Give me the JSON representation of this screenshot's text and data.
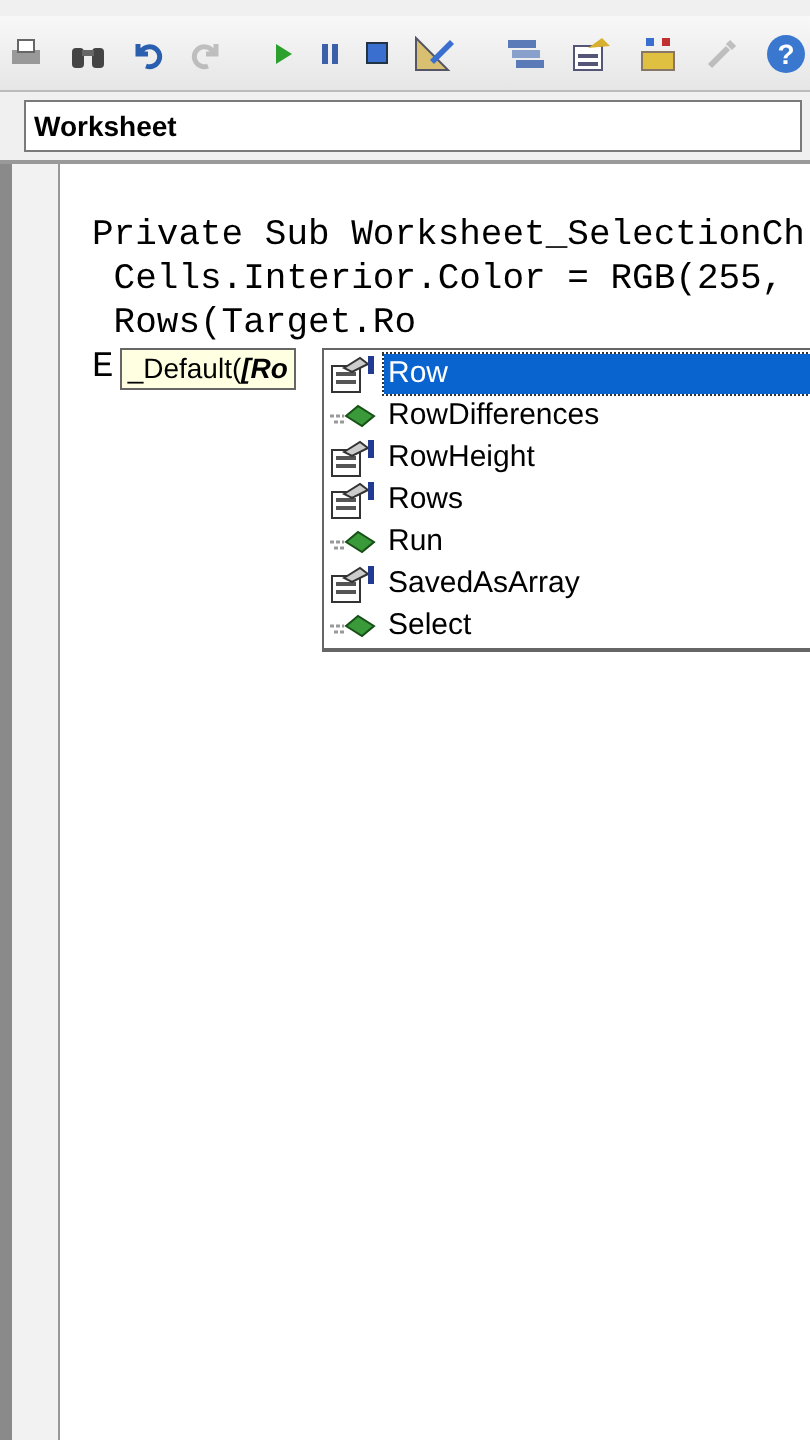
{
  "toolbar": [
    {
      "kind": "print",
      "disabled": false
    },
    {
      "kind": "find",
      "disabled": false
    },
    {
      "kind": "undo",
      "disabled": false
    },
    {
      "kind": "redo",
      "disabled": true
    },
    {
      "kind": "sep"
    },
    {
      "kind": "run",
      "disabled": false
    },
    {
      "kind": "pause",
      "disabled": false
    },
    {
      "kind": "stop",
      "disabled": false
    },
    {
      "kind": "design",
      "disabled": false
    },
    {
      "kind": "sep"
    },
    {
      "kind": "project",
      "disabled": false
    },
    {
      "kind": "properties",
      "disabled": false
    },
    {
      "kind": "toolbox",
      "disabled": false
    },
    {
      "kind": "tools",
      "disabled": true
    },
    {
      "kind": "help",
      "disabled": false,
      "glyph": "?"
    }
  ],
  "object_box": {
    "value": "Worksheet"
  },
  "code_lines": [
    "Private Sub Worksheet_SelectionCh",
    " Cells.Interior.Color = RGB(255,",
    " Rows(Target.Ro",
    "E"
  ],
  "tooltip": "_Default(**[Ro**",
  "completion_list": [
    {
      "label": "Row",
      "kind": "property",
      "selected": true
    },
    {
      "label": "RowDifferences",
      "kind": "method",
      "selected": false
    },
    {
      "label": "RowHeight",
      "kind": "property",
      "selected": false
    },
    {
      "label": "Rows",
      "kind": "property",
      "selected": false
    },
    {
      "label": "Run",
      "kind": "method",
      "selected": false
    },
    {
      "label": "SavedAsArray",
      "kind": "property",
      "selected": false
    },
    {
      "label": "Select",
      "kind": "method",
      "selected": false
    }
  ]
}
